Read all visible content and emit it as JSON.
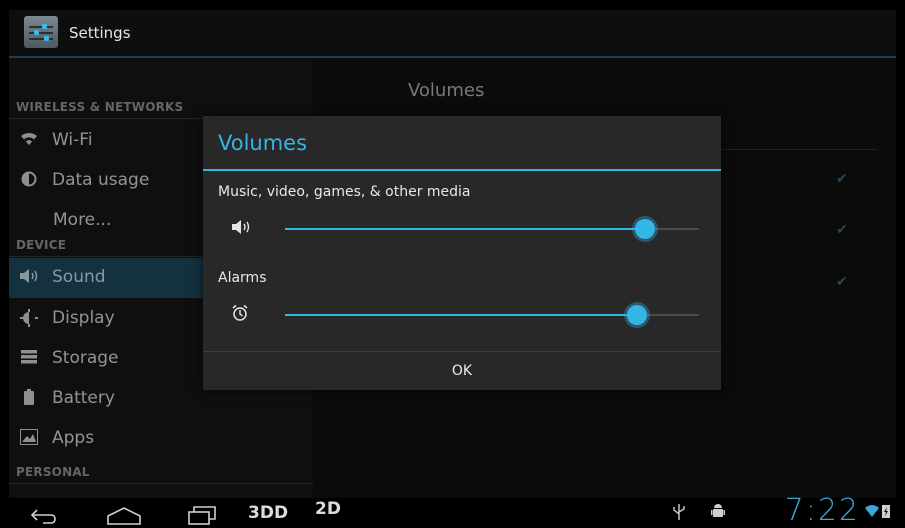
{
  "actionbar": {
    "title": "Settings",
    "icon": "settings-app-icon"
  },
  "sidebar": {
    "sections": [
      {
        "label": "WIRELESS & NETWORKS"
      },
      {
        "label": "DEVICE"
      },
      {
        "label": "PERSONAL"
      }
    ],
    "items": [
      {
        "label": "Wi-Fi",
        "icon": "wifi-icon"
      },
      {
        "label": "Data usage",
        "icon": "data-usage-icon"
      },
      {
        "label": "More...",
        "icon": ""
      },
      {
        "label": "Sound",
        "icon": "sound-icon",
        "selected": true
      },
      {
        "label": "Display",
        "icon": "display-icon"
      },
      {
        "label": "Storage",
        "icon": "storage-icon"
      },
      {
        "label": "Battery",
        "icon": "battery-icon"
      },
      {
        "label": "Apps",
        "icon": "apps-icon"
      }
    ]
  },
  "main": {
    "header": "Volumes"
  },
  "dialog": {
    "title": "Volumes",
    "sliders": [
      {
        "label": "Music, video, games, & other media",
        "icon": "speaker-icon",
        "level": 0.87
      },
      {
        "label": "Alarms",
        "icon": "alarm-clock-icon",
        "level": 0.85
      }
    ],
    "ok_label": "OK"
  },
  "navbar": {
    "btn_3d": "3DD",
    "btn_2d": "2D",
    "clock": "7:22"
  },
  "colors": {
    "accent": "#33b5e5",
    "selected_bg": "#1f4c63"
  }
}
